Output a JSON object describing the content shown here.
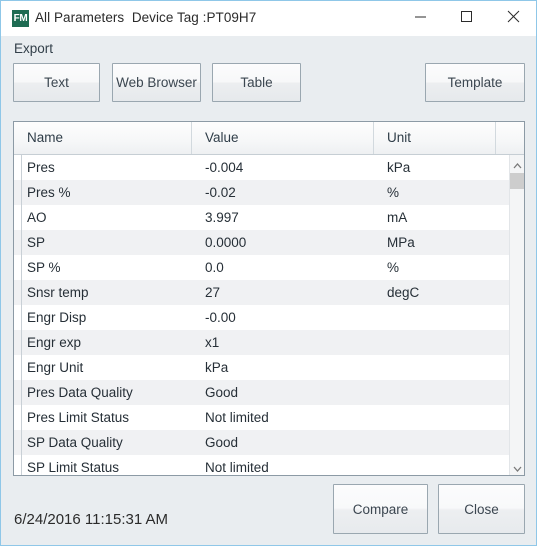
{
  "window": {
    "app_icon_label": "FM",
    "title": "All Parameters  Device Tag :PT09H7",
    "minimize_icon": "minimize-icon",
    "maximize_icon": "maximize-icon",
    "close_icon": "close-icon"
  },
  "export": {
    "label": "Export",
    "buttons": {
      "text": "Text",
      "web_browser": "Web Browser",
      "table": "Table",
      "template": "Template"
    }
  },
  "table": {
    "columns": [
      "Name",
      "Value",
      "Unit",
      ""
    ],
    "rows": [
      {
        "name": "Pres",
        "value": "-0.004",
        "unit": "kPa"
      },
      {
        "name": "Pres %",
        "value": "-0.02",
        "unit": "%"
      },
      {
        "name": "AO",
        "value": "3.997",
        "unit": "mA"
      },
      {
        "name": "SP",
        "value": "0.0000",
        "unit": "MPa"
      },
      {
        "name": "SP %",
        "value": "0.0",
        "unit": "%"
      },
      {
        "name": "Snsr temp",
        "value": "27",
        "unit": "degC"
      },
      {
        "name": "Engr Disp",
        "value": "-0.00",
        "unit": ""
      },
      {
        "name": "Engr exp",
        "value": "x1",
        "unit": ""
      },
      {
        "name": "Engr Unit",
        "value": "kPa",
        "unit": ""
      },
      {
        "name": "Pres Data Quality",
        "value": "Good",
        "unit": ""
      },
      {
        "name": "Pres Limit Status",
        "value": "Not limited",
        "unit": ""
      },
      {
        "name": "SP Data Quality",
        "value": "Good",
        "unit": ""
      },
      {
        "name": "SP Limit Status",
        "value": "Not limited",
        "unit": ""
      }
    ],
    "scrollbar": {
      "up_icon": "chevron-up-icon",
      "down_icon": "chevron-down-icon"
    }
  },
  "footer": {
    "timestamp": "6/24/2016 11:15:31 AM",
    "compare_label": "Compare",
    "close_label": "Close"
  },
  "colors": {
    "window_border": "#8fc7e8",
    "chrome_bg": "#e9edf0",
    "titlebar_bg": "#ffffff",
    "app_icon_bg": "#1e6b52",
    "row_alt_bg": "#f0f1f3",
    "table_border": "#8c9aa5",
    "scroll_thumb": "#cdcdcd"
  }
}
